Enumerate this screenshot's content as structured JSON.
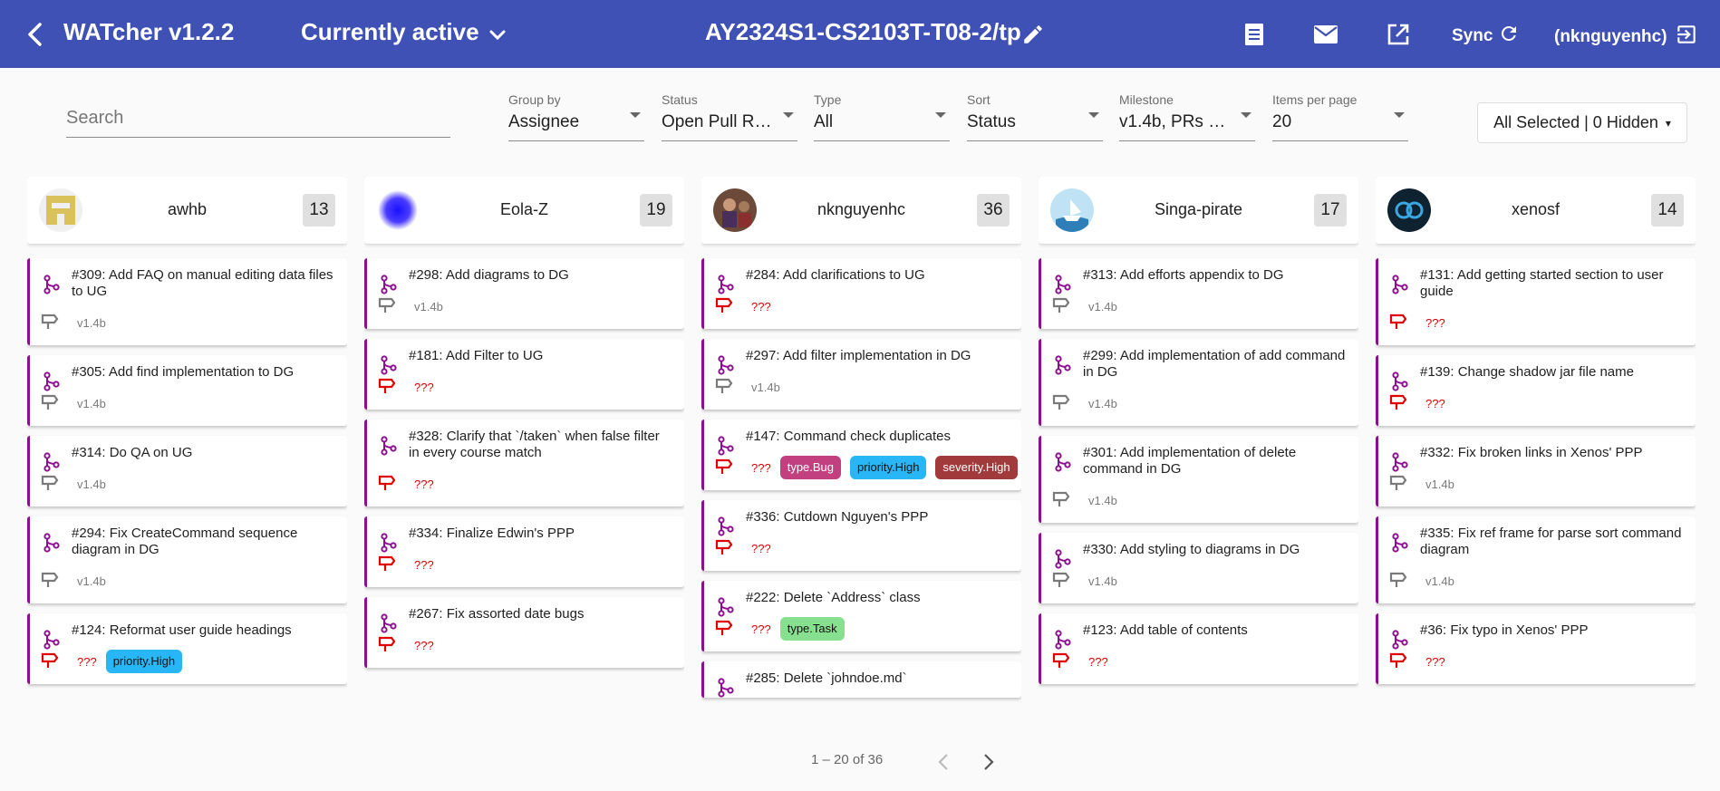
{
  "header": {
    "app_title": "WATcher v1.2.2",
    "filter_label": "Currently active",
    "repo": "AY2324S1-CS2103T-T08-2/tp",
    "sync_label": "Sync",
    "user_label": "(nknguyenhc)",
    "bg_color": "#3f51b5"
  },
  "filters": {
    "search_placeholder": "Search",
    "selects": [
      {
        "label": "Group by",
        "value": "Assignee"
      },
      {
        "label": "Status",
        "value": "Open Pull Req..."
      },
      {
        "label": "Type",
        "value": "All"
      },
      {
        "label": "Sort",
        "value": "Status"
      },
      {
        "label": "Milestone",
        "value": "v1.4b, PRs wit..."
      },
      {
        "label": "Items per page",
        "value": "20"
      }
    ],
    "columns_button": "All Selected | 0 Hidden",
    "columns_caret": "▾"
  },
  "columns": [
    {
      "name": "awhb",
      "count": "13",
      "avatar": "awhb-avatar-icon",
      "cards": [
        {
          "title": "#309: Add FAQ on manual editing data files to UG",
          "milestone": "v1.4b",
          "labels": []
        },
        {
          "title": "#305: Add find implementation to DG",
          "milestone": "v1.4b",
          "labels": []
        },
        {
          "title": "#314: Do QA on UG",
          "milestone": "v1.4b",
          "labels": []
        },
        {
          "title": "#294: Fix CreateCommand sequence diagram in DG",
          "milestone": "v1.4b",
          "labels": []
        },
        {
          "title": "#124: Reformat user guide headings",
          "milestone": "???",
          "labels": [
            {
              "text": "priority.High",
              "bg": "#29b6f6",
              "fg": "#111"
            }
          ]
        }
      ]
    },
    {
      "name": "Eola-Z",
      "count": "19",
      "avatar": "eola-z-avatar-icon",
      "cards": [
        {
          "title": "#298: Add diagrams to DG",
          "milestone": "v1.4b",
          "labels": []
        },
        {
          "title": "#181: Add Filter to UG",
          "milestone": "???",
          "labels": []
        },
        {
          "title": "#328: Clarify that `/taken` when false filter in every course match",
          "milestone": "???",
          "labels": []
        },
        {
          "title": "#334: Finalize Edwin's PPP",
          "milestone": "???",
          "labels": []
        },
        {
          "title": "#267: Fix assorted date bugs",
          "milestone": "???",
          "labels": []
        }
      ]
    },
    {
      "name": "nknguyenhc",
      "count": "36",
      "avatar": "nknguyenhc-avatar-icon",
      "cards": [
        {
          "title": "#284: Add clarifications to UG",
          "milestone": "???",
          "labels": []
        },
        {
          "title": "#297: Add filter implementation in DG",
          "milestone": "v1.4b",
          "labels": []
        },
        {
          "title": "#147: Command check duplicates",
          "milestone": "???",
          "labels": [
            {
              "text": "type.Bug",
              "bg": "#c2407f",
              "fg": "#fff"
            },
            {
              "text": "priority.High",
              "bg": "#29b6f6",
              "fg": "#111"
            },
            {
              "text": "severity.High",
              "bg": "#a13a3a",
              "fg": "#fff"
            }
          ]
        },
        {
          "title": "#336: Cutdown Nguyen's PPP",
          "milestone": "???",
          "labels": []
        },
        {
          "title": "#222: Delete `Address` class",
          "milestone": "???",
          "labels": [
            {
              "text": "type.Task",
              "bg": "#86e08f",
              "fg": "#111"
            }
          ]
        },
        {
          "title": "#285: Delete `johndoe.md`",
          "milestone": "",
          "labels": []
        }
      ]
    },
    {
      "name": "Singa-pirate",
      "count": "17",
      "avatar": "singa-pirate-avatar-icon",
      "cards": [
        {
          "title": "#313: Add efforts appendix to DG",
          "milestone": "v1.4b",
          "labels": []
        },
        {
          "title": "#299: Add implementation of add command in DG",
          "milestone": "v1.4b",
          "labels": []
        },
        {
          "title": "#301: Add implementation of delete command in DG",
          "milestone": "v1.4b",
          "labels": []
        },
        {
          "title": "#330: Add styling to diagrams in DG",
          "milestone": "v1.4b",
          "labels": []
        },
        {
          "title": "#123: Add table of contents",
          "milestone": "???",
          "labels": []
        }
      ]
    },
    {
      "name": "xenosf",
      "count": "14",
      "avatar": "xenosf-avatar-icon",
      "cards": [
        {
          "title": "#131: Add getting started section to user guide",
          "milestone": "???",
          "labels": []
        },
        {
          "title": "#139: Change shadow jar file name",
          "milestone": "???",
          "labels": []
        },
        {
          "title": "#332: Fix broken links in Xenos' PPP",
          "milestone": "v1.4b",
          "labels": []
        },
        {
          "title": "#335: Fix ref frame for parse sort command diagram",
          "milestone": "v1.4b",
          "labels": []
        },
        {
          "title": "#36: Fix typo in Xenos' PPP",
          "milestone": "???",
          "labels": []
        }
      ]
    }
  ],
  "pager": {
    "range": "1 – 20 of 36"
  },
  "colors": {
    "card_border": "#8b0f8f",
    "pr_icon": "#8b0f8f",
    "no_milestone": "#e00000",
    "milestone": "#7a7a7a"
  }
}
